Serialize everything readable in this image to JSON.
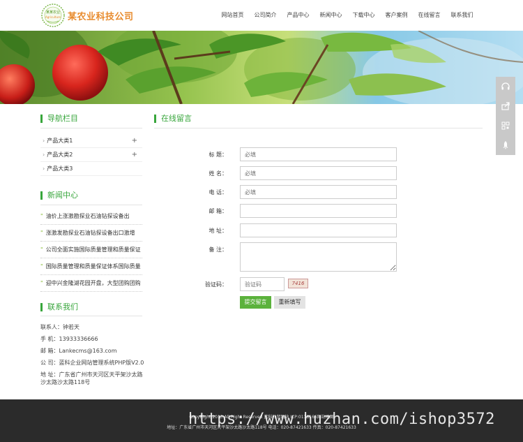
{
  "header": {
    "logo_text_top": "某某农业",
    "logo_text_bottom": "Agriculture",
    "site_name": "某农业科技公司",
    "nav": [
      {
        "label": "网站首页"
      },
      {
        "label": "公司简介"
      },
      {
        "label": "产品中心"
      },
      {
        "label": "新闻中心"
      },
      {
        "label": "下载中心"
      },
      {
        "label": "客户案例"
      },
      {
        "label": "在线留言"
      },
      {
        "label": "联系我们"
      }
    ]
  },
  "tools": [
    "headset-icon",
    "share-icon",
    "qrcode-icon",
    "rocket-icon"
  ],
  "sidebar": {
    "nav_title": "导航栏目",
    "categories": [
      {
        "label": "产品大类1",
        "plus": "+"
      },
      {
        "label": "产品大类2",
        "plus": "+"
      },
      {
        "label": "产品大类3",
        "plus": ""
      }
    ],
    "news_title": "新闻中心",
    "news": [
      {
        "label": "油价上涨激勘探业石油钻探设备出"
      },
      {
        "label": "涨激发勘探业石油钻探设备出口激增"
      },
      {
        "label": "公司全面实施国际质量管理和质量保证"
      },
      {
        "label": "国际质量管理和质量保证体系国际质量"
      },
      {
        "label": "迎中兴金隆湖花园开盘，大型团购团购"
      }
    ],
    "contact_title": "联系我们",
    "contact": {
      "person": "联系人：钟若天",
      "phone": "手 机：13933336666",
      "email": "邮 箱：Lankecms@163.com",
      "company": "公 司：蓝科企业网站管理系统PHP版V2.0",
      "address1": "地 址：广东省广州市天河区天平架沙太路",
      "address2": "沙太路沙太路118号"
    }
  },
  "main": {
    "title": "在线留言",
    "form": {
      "subject_label": "标 题：",
      "subject_placeholder": "必填",
      "name_label": "姓 名：",
      "name_placeholder": "必填",
      "phone_label": "电 话：",
      "phone_placeholder": "必填",
      "email_label": "邮 箱：",
      "address_label": "地 址：",
      "note_label": "备 注：",
      "captcha_label": "验证码：",
      "captcha_placeholder": "验证码",
      "captcha_image_text": "7416",
      "submit_label": "提交留言",
      "reset_label": "重新填写"
    }
  },
  "footer": {
    "line1": "CopyRight 2013 All Right Reserved 蓝科外贸网站 ICP:0118166网站地图",
    "line2": "地址：广东省广州市天河区天平架沙太路沙太路118号  电话：020-87421633  传真：020-87421633",
    "watermark": "https://www.huzhan.com/ishop3572"
  }
}
